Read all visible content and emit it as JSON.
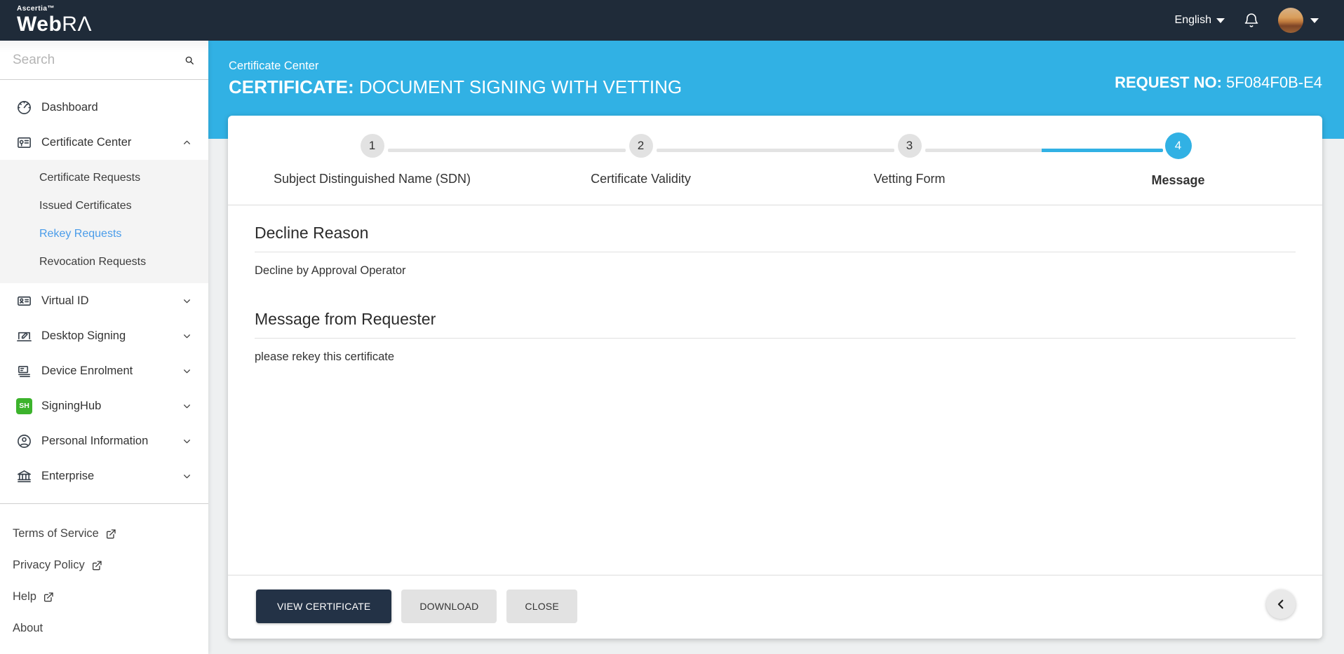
{
  "topbar": {
    "brand_small": "Ascertia™",
    "brand_web": "Web",
    "brand_ra": "RΛ",
    "language": "English"
  },
  "sidebar": {
    "search_placeholder": "Search",
    "main": [
      {
        "label": "Dashboard"
      },
      {
        "label": "Certificate Center"
      },
      {
        "label": "Virtual ID"
      },
      {
        "label": "Desktop Signing"
      },
      {
        "label": "Device Enrolment"
      },
      {
        "label": "SigningHub",
        "badge": "SH"
      },
      {
        "label": "Personal Information"
      },
      {
        "label": "Enterprise"
      }
    ],
    "certificate_center_submenu": [
      {
        "label": "Certificate Requests"
      },
      {
        "label": "Issued Certificates"
      },
      {
        "label": "Rekey Requests",
        "active": true
      },
      {
        "label": "Revocation Requests"
      }
    ],
    "footer_links": [
      {
        "label": "Terms of Service",
        "external": true
      },
      {
        "label": "Privacy Policy",
        "external": true
      },
      {
        "label": "Help",
        "external": true
      },
      {
        "label": "About",
        "external": false
      }
    ]
  },
  "header": {
    "breadcrumb": "Certificate Center",
    "title_prefix": "CERTIFICATE:",
    "title_rest": " DOCUMENT SIGNING WITH VETTING",
    "request_label": "REQUEST NO:",
    "request_value": " 5F084F0B-E4"
  },
  "stepper": {
    "steps": [
      {
        "num": "1",
        "label": "Subject Distinguished Name (SDN)"
      },
      {
        "num": "2",
        "label": "Certificate Validity"
      },
      {
        "num": "3",
        "label": "Vetting Form"
      },
      {
        "num": "4",
        "label": "Message",
        "active": true
      }
    ]
  },
  "sections": [
    {
      "heading": "Decline Reason",
      "body": "Decline by Approval Operator"
    },
    {
      "heading": "Message from Requester",
      "body": "please rekey this certificate"
    }
  ],
  "footer_buttons": {
    "view_certificate": "VIEW CERTIFICATE",
    "download": "DOWNLOAD",
    "close": "CLOSE"
  },
  "colors": {
    "topbar": "#1f2b39",
    "accent_blue": "#31b1e4",
    "active_link": "#4a9ce9",
    "dark_button": "#233246",
    "signinghub_green": "#3cb32c"
  }
}
